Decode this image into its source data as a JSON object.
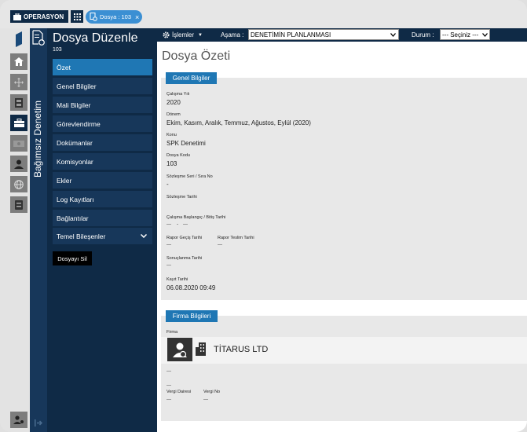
{
  "topbar": {
    "operasyon_label": "OPERASYON",
    "tab_label": "Dosya : 103",
    "tab_close": "×"
  },
  "sidebar": {
    "vertical_title": "Bağımsız Denetim",
    "title": "Dosya Düzenle",
    "subtitle": "103",
    "items": [
      {
        "label": "Özet"
      },
      {
        "label": "Genel Bilgiler"
      },
      {
        "label": "Mali Bilgiler"
      },
      {
        "label": "Görevlendirme"
      },
      {
        "label": "Dokümanlar"
      },
      {
        "label": "Komisyonlar"
      },
      {
        "label": "Ekler"
      },
      {
        "label": "Log Kayıtları"
      },
      {
        "label": "Bağlantılar"
      },
      {
        "label": "Temel Bileşenler"
      }
    ],
    "delete_label": "Dosyayı Sil"
  },
  "toolbar": {
    "islemler_label": "İşlemler",
    "asama_label": "Aşama :",
    "asama_value": "DENETİMİN PLANLANMASI",
    "durum_label": "Durum :",
    "durum_value": "--- Seçiniz ---"
  },
  "page": {
    "title": "Dosya Özeti"
  },
  "genel": {
    "tab": "Genel Bilgiler",
    "calisma_yili_label": "Çalışma Yılı",
    "calisma_yili": "2020",
    "donem_label": "Dönem",
    "donem": "Ekim, Kasım, Aralık, Temmuz, Ağustos, Eylül (2020)",
    "konu_label": "Konu",
    "konu": "SPK Denetimi",
    "dosya_kodu_label": "Dosya Kodu",
    "dosya_kodu": "103",
    "sozlesme_no_label": "Sözleşme Seri / Sıra No",
    "sozlesme_no": "-",
    "sozlesme_tarihi_label": "Sözleşme Tarihi",
    "calisma_tarih_label": "Çalışma Başlangıç / Bitiş Tarihi",
    "calisma_bas": "---",
    "calisma_sep": "-",
    "calisma_bit": "---",
    "rapor_gecis_label": "Rapor Geçiş Tarihi",
    "rapor_gecis": "---",
    "rapor_teslim_label": "Rapor Teslim Tarihi",
    "rapor_teslim": "---",
    "sonuclanma_label": "Sonuçlanma Tarihi",
    "sonuclanma": "---",
    "kayit_label": "Kayıt Tarihi",
    "kayit": "06.08.2020 09:49"
  },
  "firma": {
    "tab": "Firma Bilgileri",
    "firma_label": "Firma",
    "firma_name": "TİTARUS LTD",
    "line1": "---",
    "line2": "---",
    "vergi_dairesi_label": "Vergi Dairesi",
    "vergi_dairesi": "---",
    "vergi_no_label": "Vergi No",
    "vergi_no": "---"
  }
}
